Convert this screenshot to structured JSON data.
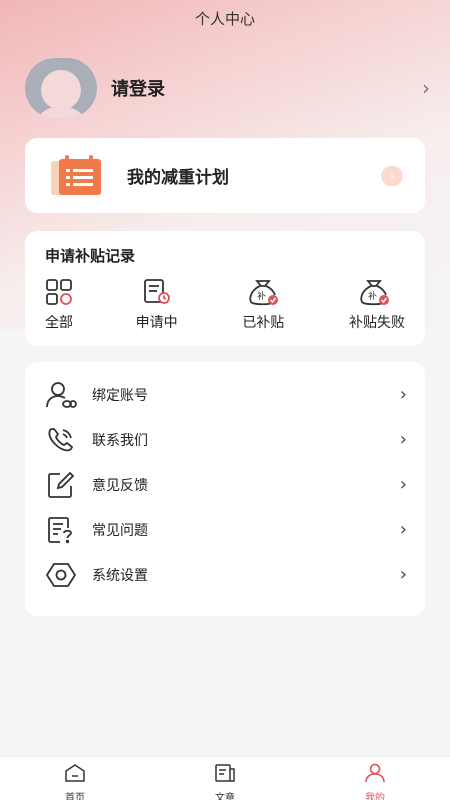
{
  "header": {
    "title": "个人中心"
  },
  "profile": {
    "login_label": "请登录"
  },
  "plan": {
    "title": "我的减重计划"
  },
  "subsidy": {
    "title": "申请补贴记录",
    "items": [
      {
        "label": "全部",
        "icon": "grid-icon"
      },
      {
        "label": "申请中",
        "icon": "document-clock-icon"
      },
      {
        "label": "已补贴",
        "icon": "money-bag-check-icon"
      },
      {
        "label": "补贴失败",
        "icon": "money-bag-fail-icon"
      }
    ]
  },
  "menu": {
    "items": [
      {
        "label": "绑定账号",
        "icon": "user-link-icon"
      },
      {
        "label": "联系我们",
        "icon": "phone-icon"
      },
      {
        "label": "意见反馈",
        "icon": "edit-icon"
      },
      {
        "label": "常见问题",
        "icon": "faq-icon"
      },
      {
        "label": "系统设置",
        "icon": "settings-icon"
      }
    ]
  },
  "tabbar": {
    "items": [
      {
        "label": "首页",
        "icon": "home-icon"
      },
      {
        "label": "文章",
        "icon": "article-icon"
      },
      {
        "label": "我的",
        "icon": "profile-icon",
        "active": true
      }
    ]
  },
  "colors": {
    "accent": "#e0505a",
    "plan_icon": "#f07a4a"
  }
}
